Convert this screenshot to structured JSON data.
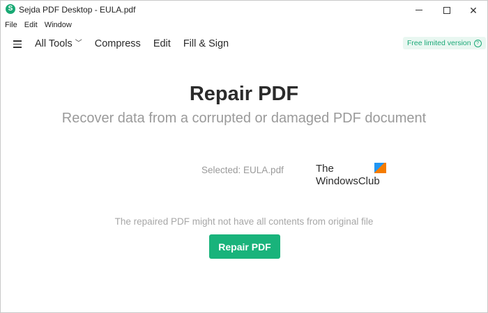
{
  "window": {
    "title": "Sejda PDF Desktop - EULA.pdf",
    "app_icon_letter": "S"
  },
  "menu": [
    "File",
    "Edit",
    "Window"
  ],
  "toolbar": {
    "all_tools_label": "All Tools",
    "compress_label": "Compress",
    "edit_label": "Edit",
    "fill_sign_label": "Fill & Sign",
    "badge_label": "Free limited version",
    "badge_help": "?"
  },
  "main": {
    "title": "Repair PDF",
    "subtitle": "Recover data from a corrupted or damaged PDF document",
    "selected_file": "Selected: EULA.pdf",
    "note": "The repaired PDF might not have all contents from original file",
    "repair_button": "Repair PDF"
  },
  "watermark": {
    "line1": "The",
    "line2": "WindowsClub"
  },
  "colors": {
    "accent": "#19b37b",
    "badge_bg": "#e9f7f1",
    "muted_text": "#9a9a9a"
  }
}
